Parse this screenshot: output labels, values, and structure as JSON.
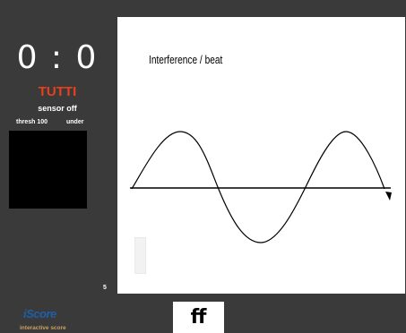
{
  "counter": {
    "text": "0 : 0"
  },
  "section": {
    "label": "TUTTI",
    "color": "#e8401c"
  },
  "sensor": {
    "status": "sensor off",
    "threshold_label": "thresh 100",
    "mode": "under"
  },
  "page": {
    "number": "5"
  },
  "score": {
    "title": "Interference / beat",
    "wave": {
      "shape": "sine",
      "cycles_visible": 2
    }
  },
  "slider": {
    "level": 0
  },
  "brand": {
    "name": "iScore",
    "tagline": "interactive score",
    "color": "#1e5fa8"
  },
  "dynamic": {
    "marking": "ff"
  },
  "icons": {
    "axis_arrow": "arrowhead-right-down"
  }
}
